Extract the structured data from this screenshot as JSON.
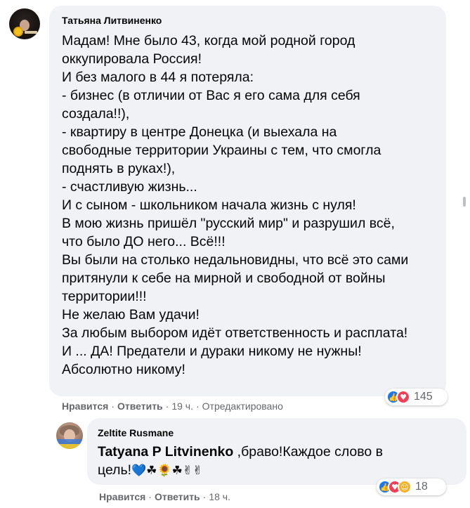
{
  "comment": {
    "author": "Татьяна Литвиненко",
    "lines": [
      "Мадам! Мне было 43, когда мой родной город",
      "оккупировала Россия!",
      "И без малого в 44 я потеряла:",
      "- бизнес (в отличии от Вас я его сама для себя",
      "создала!!),",
      "- квартиру в центре Донецка (и выехала на",
      "свободные территории Украины с тем, что смогла",
      "поднять в руках!),",
      "- счастливую жизнь...",
      "И с сыном - школьником начала жизнь с нуля!",
      "В мою жизнь пришёл \"русский мир\" и разрушил всё,",
      "что было ДО него... Всё!!!",
      "Вы были на столько недальновидны, что всё это сами",
      "притянули к себе на мирной и свободной от войны",
      "территории!!!",
      "Не желаю Вам удачи!",
      "За любым выбором идёт ответственность и расплата!",
      "И ... ДА! Предатели и дураки никому не нужны!",
      "Абсолютно никому!"
    ],
    "reactions": {
      "icons": [
        "like-icon",
        "love-icon"
      ],
      "count": "145"
    },
    "actions": {
      "like": "Нравится",
      "reply": "Ответить",
      "time": "19 ч.",
      "edited": "Отредактировано",
      "sep": "·"
    }
  },
  "reply": {
    "author": "Zeltite Rusmane",
    "mention": "Tatyana P Litvinenko",
    "line1_rest": " ,браво!Каждое слово в",
    "line2": "цель!",
    "emojis": "💙☘🌻☘✌✌",
    "reactions": {
      "icons": [
        "like-icon",
        "love-icon",
        "care-icon"
      ],
      "count": "18"
    },
    "actions": {
      "like": "Нравится",
      "reply": "Ответить",
      "time": "18 ч.",
      "sep": "·"
    }
  },
  "colors": {
    "bubble": "#f0f2f5",
    "meta": "#65676b",
    "like": "#1877f2",
    "love": "#f33e58",
    "care": "#f7b125"
  }
}
